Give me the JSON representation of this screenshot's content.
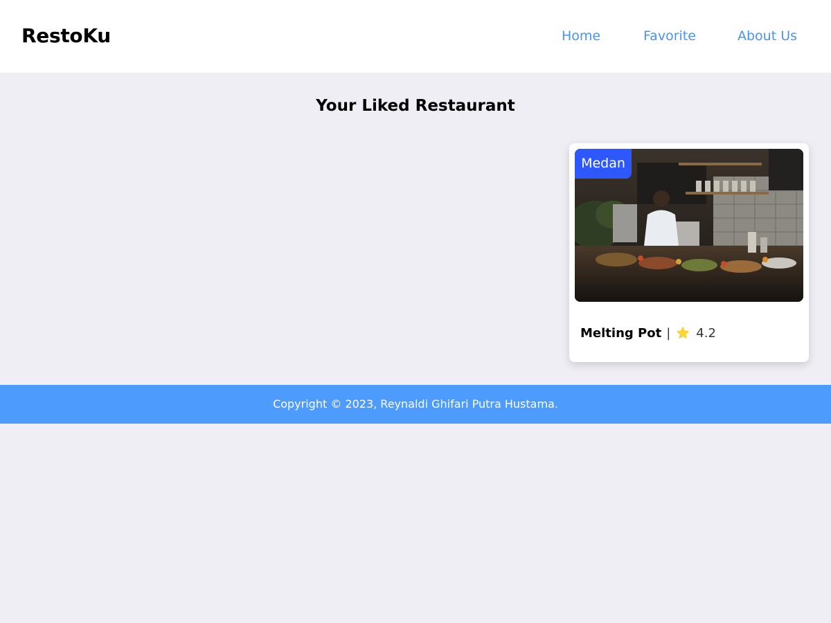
{
  "header": {
    "brand": "RestoKu",
    "nav": [
      {
        "label": "Home"
      },
      {
        "label": "Favorite"
      },
      {
        "label": "About Us"
      }
    ]
  },
  "main": {
    "title": "Your Liked Restaurant",
    "restaurants": [
      {
        "city": "Medan",
        "name": "Melting Pot",
        "separator": "|",
        "rating": "4.2",
        "rating_icon": "star-icon",
        "image": "restaurant-photo"
      }
    ]
  },
  "footer": {
    "copyright": "Copyright © 2023, Reynaldi Ghifari Putra Hustama."
  },
  "colors": {
    "background": "#efeef4",
    "nav_link": "#4b93ee",
    "badge": "#2d57ff",
    "footer": "#4c9bfd",
    "star": "#fdd835"
  }
}
